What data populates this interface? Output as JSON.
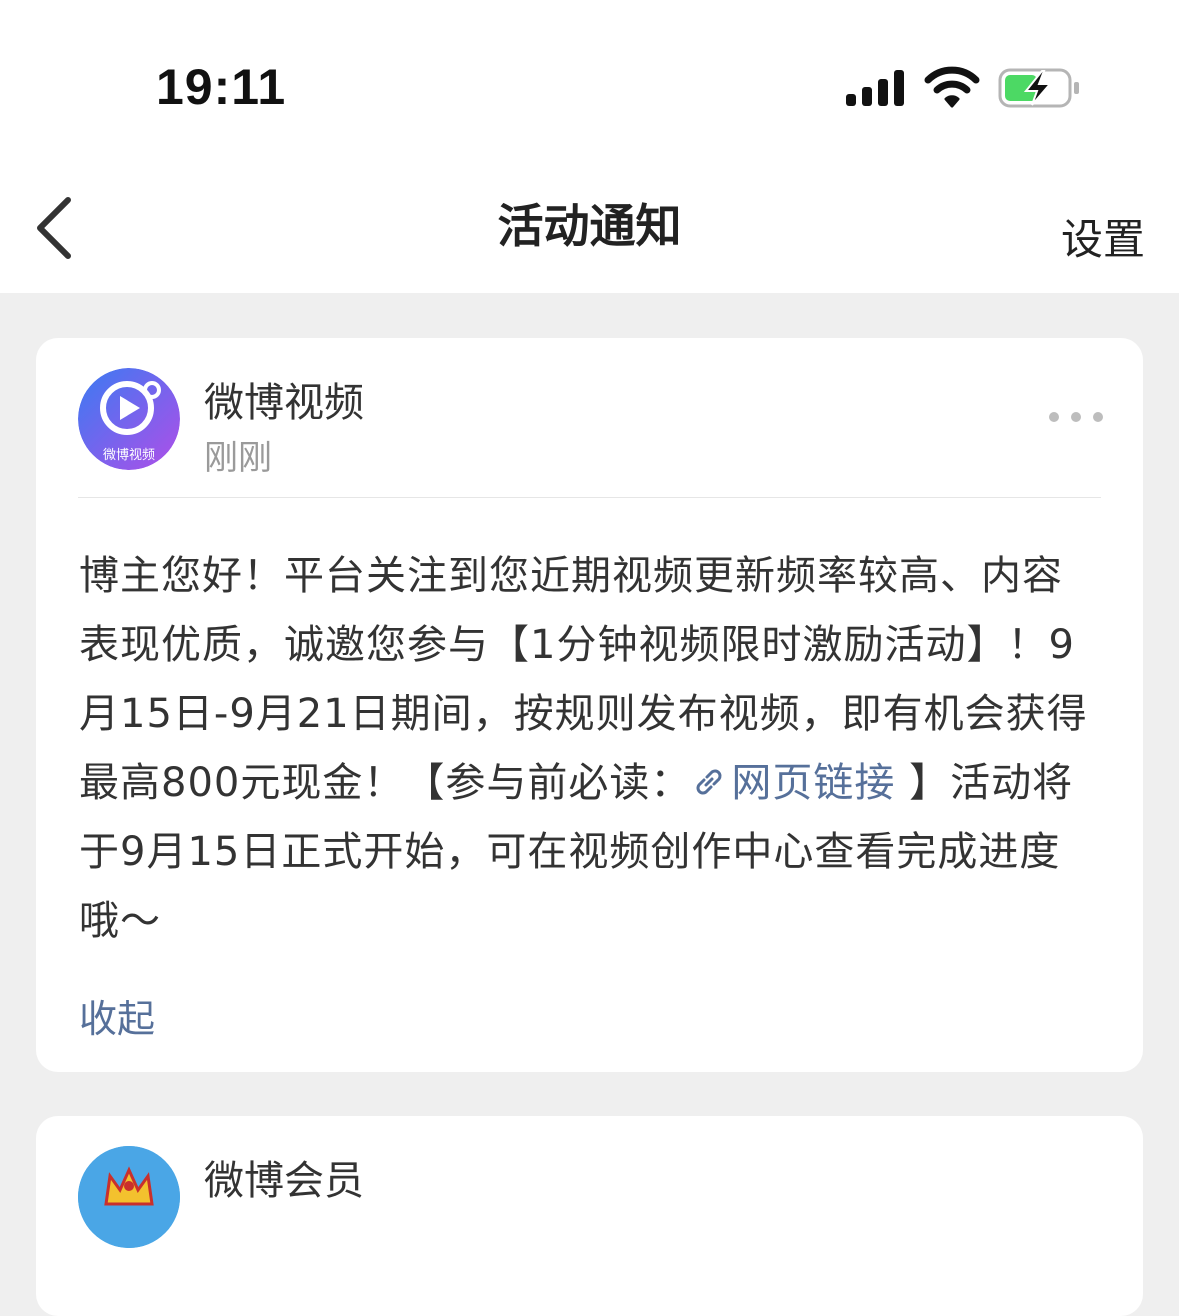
{
  "status_bar": {
    "time": "19:11"
  },
  "nav": {
    "title": "活动通知",
    "settings_label": "设置"
  },
  "notifications": [
    {
      "sender": "微博视频",
      "avatar_text": "微博视频",
      "time": "刚刚",
      "message_before": "博主您好！平台关注到您近期视频更新频率较高、内容表现优质，诚邀您参与【1分钟视频限时激励活动】！9月15日-9月21日期间，按规则发布视频，即有机会获得最高800元现金！【参与前必读：",
      "link_text": "网页链接",
      "message_after": " 】活动将于9月15日正式开始，可在视频创作中心查看完成进度哦～",
      "collapse_label": "收起"
    },
    {
      "sender": "微博会员"
    }
  ],
  "colors": {
    "link": "#56709a",
    "battery": "#4cd964",
    "avatar_gradient": [
      "#3a7bf2",
      "#b04ee8"
    ]
  }
}
